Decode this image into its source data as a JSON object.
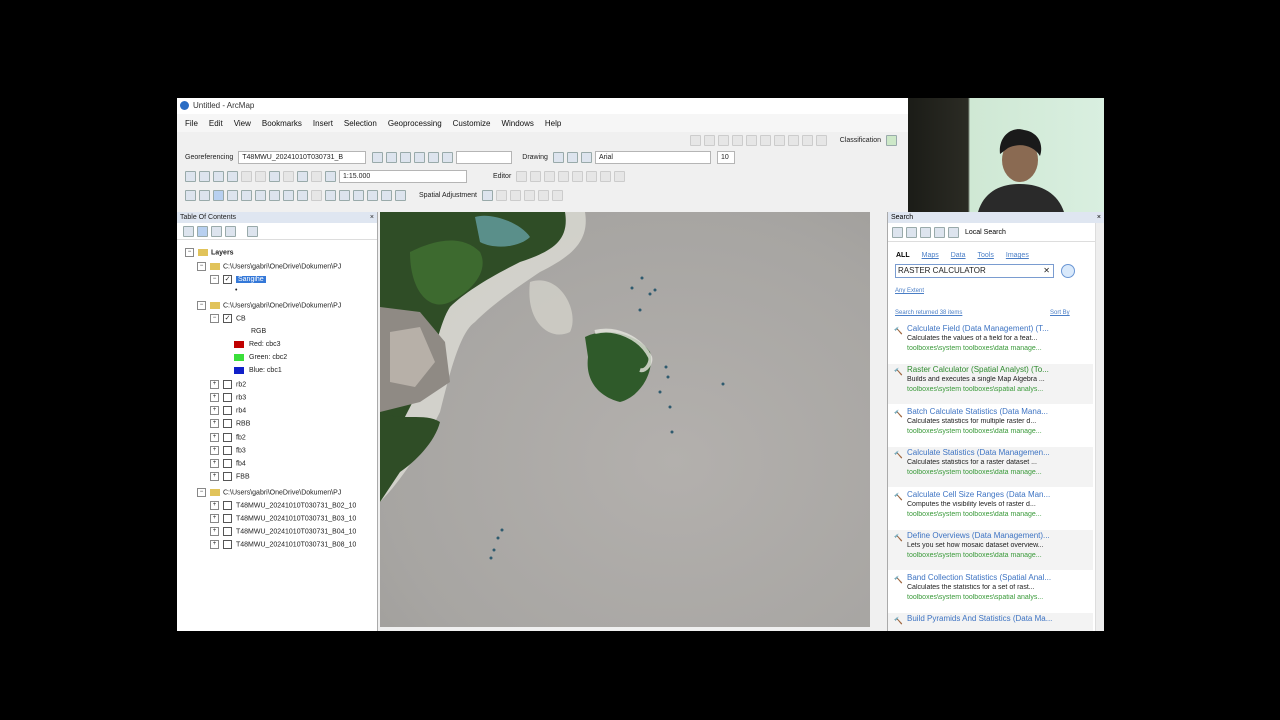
{
  "window": {
    "title": "Untitled - ArcMap"
  },
  "menu": [
    "File",
    "Edit",
    "View",
    "Bookmarks",
    "Insert",
    "Selection",
    "Geoprocessing",
    "Customize",
    "Windows",
    "Help"
  ],
  "toolbar": {
    "classification": "Classification",
    "georeferencing": "Georeferencing",
    "georef_layer": "T48MWU_20241010T030731_B",
    "drawing": "Drawing",
    "font": "Arial",
    "font_size": "10",
    "scale": "1:15.000",
    "editor": "Editor",
    "spatial_adjustment": "Spatial Adjustment"
  },
  "toc": {
    "title": "Table Of Contents",
    "layers_root": "Layers",
    "group1_path": "C:\\Users\\gabri\\OneDrive\\Dokumen\\PJ",
    "group1_layer": "Sangihe",
    "group2_path": "C:\\Users\\gabri\\OneDrive\\Dokumen\\PJ",
    "cb_layer": "CB",
    "rgb_label": "RGB",
    "red": "Red:",
    "red_band": "cbc3",
    "green": "Green:",
    "green_band": "cbc2",
    "blue": "Blue:",
    "blue_band": "cbc1",
    "sublayers": [
      "rb2",
      "rb3",
      "rb4",
      "RBB",
      "fb2",
      "fb3",
      "fb4",
      "FBB"
    ],
    "group3_path": "C:\\Users\\gabri\\OneDrive\\Dokumen\\PJ",
    "group3_layers": [
      "T48MWU_20241010T030731_B02_10",
      "T48MWU_20241010T030731_B03_10",
      "T48MWU_20241010T030731_B04_10",
      "T48MWU_20241010T030731_B08_10"
    ]
  },
  "search": {
    "title": "Search",
    "scope": "Local Search",
    "tabs": [
      "ALL",
      "Maps",
      "Data",
      "Tools",
      "Images"
    ],
    "query": "RASTER CALCULATOR",
    "any_extent": "Any Extent",
    "returned": "Search returned 38 items",
    "sort": "Sort By",
    "results": [
      {
        "title": "Calculate Field (Data Management) (T...",
        "desc": "Calculates the values of a field for a feat...",
        "path": "toolboxes\\system toolboxes\\data manage..."
      },
      {
        "title": "Raster Calculator (Spatial Analyst) (To...",
        "desc": "Builds and executes a single Map Algebra ...",
        "path": "toolboxes\\system toolboxes\\spatial analys..."
      },
      {
        "title": "Batch Calculate Statistics (Data Mana...",
        "desc": "Calculates statistics for multiple raster d...",
        "path": "toolboxes\\system toolboxes\\data manage..."
      },
      {
        "title": "Calculate Statistics (Data Managemen...",
        "desc": "Calculates statistics for a raster dataset ...",
        "path": "toolboxes\\system toolboxes\\data manage..."
      },
      {
        "title": "Calculate Cell Size Ranges (Data Man...",
        "desc": "Computes the visibility levels of raster d...",
        "path": "toolboxes\\system toolboxes\\data manage..."
      },
      {
        "title": "Define Overviews (Data Management)...",
        "desc": "Lets you set how mosaic dataset overview...",
        "path": "toolboxes\\system toolboxes\\data manage..."
      },
      {
        "title": "Band Collection Statistics (Spatial Anal...",
        "desc": "Calculates the statistics for a set of rast...",
        "path": "toolboxes\\system toolboxes\\spatial analys..."
      },
      {
        "title": "Build Pyramids And Statistics (Data Ma...",
        "desc": "",
        "path": ""
      }
    ]
  },
  "colors": {
    "red_swatch": "#c00000",
    "green_swatch": "#3adf3a",
    "blue_swatch": "#1020c8",
    "link": "#3e74c3",
    "path_green": "#3a9a3a"
  }
}
